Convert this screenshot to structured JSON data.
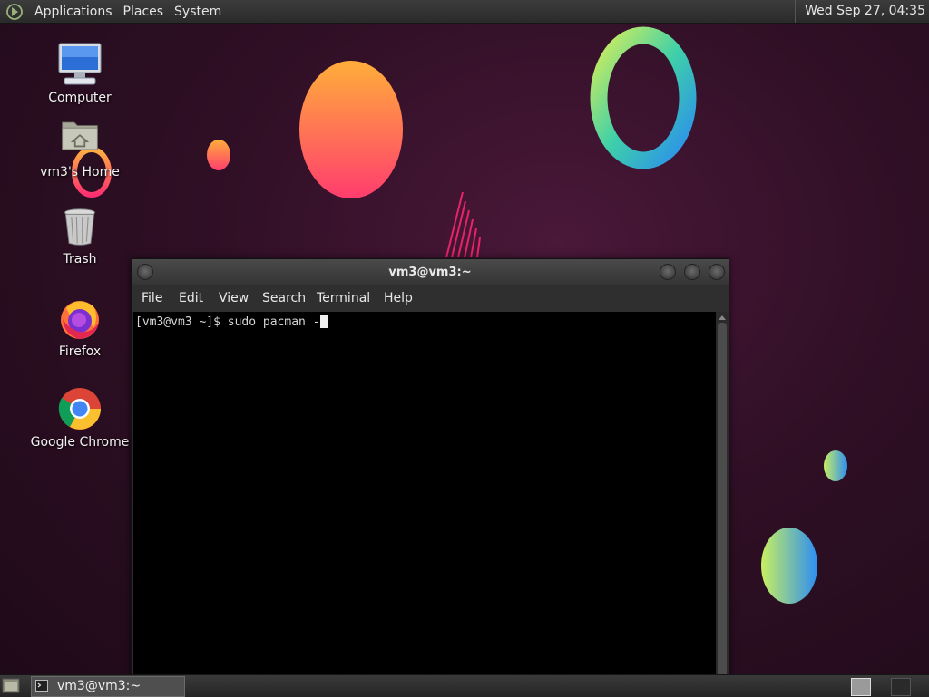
{
  "top_panel": {
    "menus": [
      "Applications",
      "Places",
      "System"
    ],
    "clock": "Wed Sep 27, 04:35"
  },
  "desktop": {
    "icons": [
      {
        "label": "Computer",
        "icon": "computer-icon"
      },
      {
        "label": "vm3's Home",
        "icon": "home-folder-icon"
      },
      {
        "label": "Trash",
        "icon": "trash-icon"
      },
      {
        "label": "Firefox",
        "icon": "firefox-icon"
      },
      {
        "label": "Google Chrome",
        "icon": "chrome-icon"
      }
    ]
  },
  "terminal": {
    "title": "vm3@vm3:~",
    "menus": [
      "File",
      "Edit",
      "View",
      "Search",
      "Terminal",
      "Help"
    ],
    "prompt": "[vm3@vm3 ~]$ ",
    "command": "sudo pacman -"
  },
  "taskbar": {
    "tasks": [
      {
        "label": "vm3@vm3:~",
        "icon": "terminal-icon"
      }
    ],
    "workspaces": [
      {
        "active": true
      },
      {
        "active": false
      }
    ]
  },
  "colors": {
    "desktop_bg": "#2f0f25",
    "panel_bg": "#2f2f2f",
    "terminal_bg": "#000000"
  }
}
